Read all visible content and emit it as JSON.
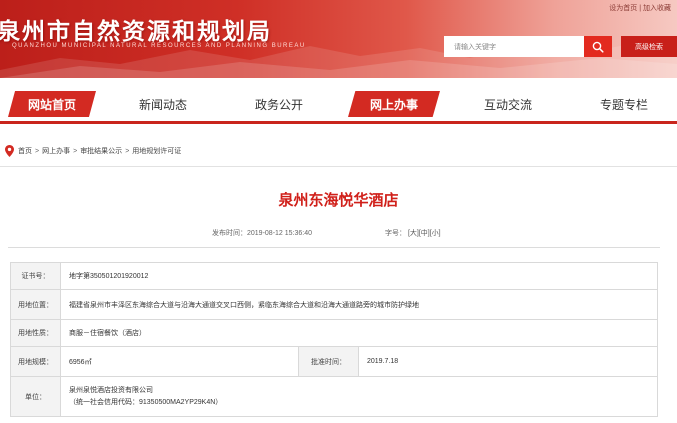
{
  "header": {
    "title": "泉州市自然资源和规划局",
    "subtitle": "QUANZHOU MUNICIPAL NATURAL RESOURCES AND PLANNING BUREAU",
    "top_links": "设为首页 | 加入收藏",
    "search": {
      "placeholder": "请输入关键字"
    },
    "advanced_search_label": "高级检索"
  },
  "nav": {
    "items": [
      {
        "label": "网站首页",
        "active": true
      },
      {
        "label": "新闻动态",
        "active": false
      },
      {
        "label": "政务公开",
        "active": false
      },
      {
        "label": "网上办事",
        "active": true
      },
      {
        "label": "互动交流",
        "active": false
      },
      {
        "label": "专题专栏",
        "active": false
      }
    ]
  },
  "breadcrumb": {
    "items": [
      "首页",
      "网上办事",
      "审批结果公示",
      "用地规划许可证"
    ],
    "separator": ">"
  },
  "article": {
    "title": "泉州东海悦华酒店",
    "publish_label": "发布时间：",
    "publish_time": "2019-08-12 15:36:40",
    "font_size_label": "字号：",
    "font_sizes": [
      "[大]",
      "[中]",
      "[小]"
    ]
  },
  "permit": {
    "cert_no": {
      "label": "证书号：",
      "value": "地字第350501201920012"
    },
    "location": {
      "label": "用地位置：",
      "value": "福建省泉州市丰泽区东海综合大道与沿海大通道交叉口西侧，紧临东海综合大道和沿海大通道路旁的城市防护绿地"
    },
    "nature": {
      "label": "用地性质：",
      "value": "商服－住宿餐饮（酒店）"
    },
    "area": {
      "label": "用地规模：",
      "value": "6956㎡"
    },
    "approval": {
      "label": "批准时间：",
      "value": "2019.7.18"
    },
    "unit": {
      "label": "单位：",
      "name": "泉州泉悦酒店投资有限公司",
      "credit_code": "（统一社会信用代码：91350500MA2YP29K4N）"
    }
  },
  "colors": {
    "brand_red": "#d32a22",
    "title_red": "#d0201a",
    "search_button": "#e32a1f"
  },
  "icons": [
    "search-icon",
    "location-pin-icon"
  ]
}
